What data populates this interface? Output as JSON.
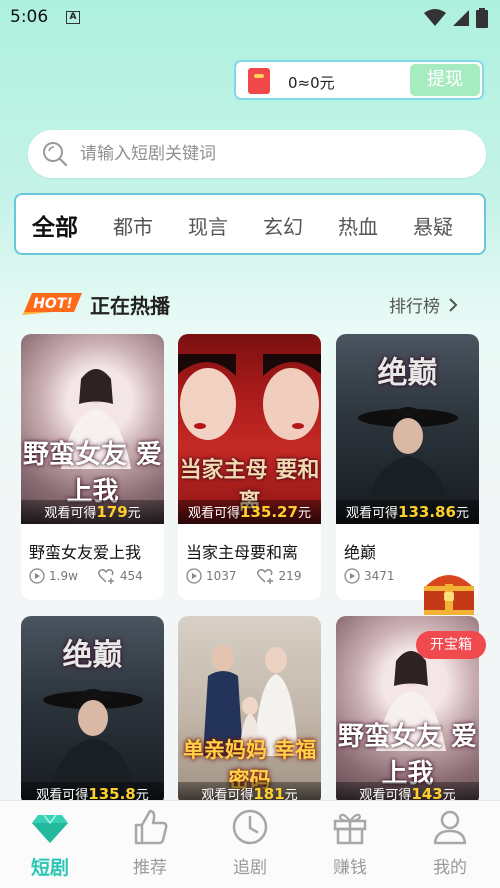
{
  "status": {
    "time": "5:06",
    "a_icon": "A"
  },
  "wallet": {
    "amount": "0≈0元",
    "withdraw_label": "提现"
  },
  "search": {
    "placeholder": "请输入短剧关键词"
  },
  "categories": [
    "全部",
    "都市",
    "现言",
    "玄幻",
    "热血",
    "悬疑"
  ],
  "section": {
    "badge": "HOT!",
    "title": "正在热播",
    "rank_label": "排行榜"
  },
  "earn_prefix": "观看可得",
  "earn_suffix": "元",
  "cards": [
    {
      "poster_text": "野蛮女友 爱上我",
      "earn": "179",
      "title": "野蛮女友爱上我",
      "views": "1.9w",
      "likes": "454"
    },
    {
      "poster_text": "当家主母 要和离",
      "earn": "135.27",
      "title": "当家主母要和离",
      "views": "1037",
      "likes": "219"
    },
    {
      "poster_text": "绝巅",
      "earn": "133.86",
      "title": "绝巅",
      "views": "3471",
      "likes": ""
    },
    {
      "poster_text": "绝巅",
      "earn": "135.8",
      "title": "",
      "views": "",
      "likes": ""
    },
    {
      "poster_text": "单亲妈妈 幸福密码",
      "earn": "181",
      "title": "",
      "views": "",
      "likes": ""
    },
    {
      "poster_text": "野蛮女友 爱上我",
      "earn": "143",
      "title": "",
      "views": "",
      "likes": ""
    }
  ],
  "treasure": {
    "label": "开宝箱"
  },
  "nav": [
    {
      "label": "短剧",
      "icon": "diamond-icon"
    },
    {
      "label": "推荐",
      "icon": "thumbs-up-icon"
    },
    {
      "label": "追剧",
      "icon": "clock-icon"
    },
    {
      "label": "赚钱",
      "icon": "gift-icon"
    },
    {
      "label": "我的",
      "icon": "person-icon"
    }
  ],
  "colors": {
    "accent": "#2cc6b4",
    "earn": "#ffcf2b",
    "treasure_btn": "#f04a4f",
    "category_border": "#69c7dc"
  }
}
